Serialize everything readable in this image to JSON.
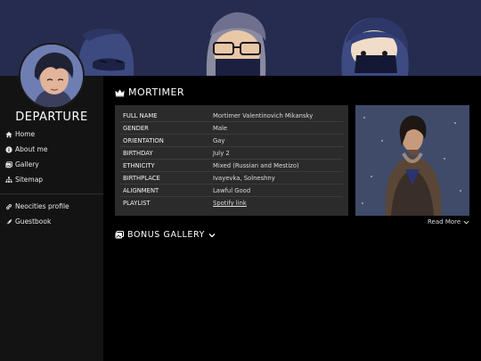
{
  "site": {
    "title": "DEPARTURE"
  },
  "nav": {
    "primary": [
      {
        "label": "Home",
        "icon": "home-icon"
      },
      {
        "label": "About me",
        "icon": "info-icon"
      },
      {
        "label": "Gallery",
        "icon": "gallery-icon"
      },
      {
        "label": "Sitemap",
        "icon": "sitemap-icon"
      }
    ],
    "secondary": [
      {
        "label": "Neocities profile",
        "icon": "link-icon"
      },
      {
        "label": "Guestbook",
        "icon": "feather-icon"
      }
    ]
  },
  "profile": {
    "title": "MORTIMER",
    "rows": [
      {
        "key": "FULL NAME",
        "value": "Mortimer Valentinovich Mikansky"
      },
      {
        "key": "GENDER",
        "value": "Male"
      },
      {
        "key": "ORIENTATION",
        "value": "Gay"
      },
      {
        "key": "BIRTHDAY",
        "value": "July 2"
      },
      {
        "key": "ETHNICITY",
        "value": "Mixed (Russian and Mestizo)"
      },
      {
        "key": "BIRTHPLACE",
        "value": "Ivayevka, Solneshny"
      },
      {
        "key": "ALIGNMENT",
        "value": "Lawful Good"
      },
      {
        "key": "PLAYLIST",
        "value": "Spotify link"
      }
    ],
    "read_more": "Read More"
  },
  "bonus": {
    "label": "BONUS GALLERY"
  },
  "colors": {
    "banner": "#262c4f",
    "sidebar": "#131313",
    "main_bg": "#000000",
    "info_box": "#2b2b2b"
  }
}
